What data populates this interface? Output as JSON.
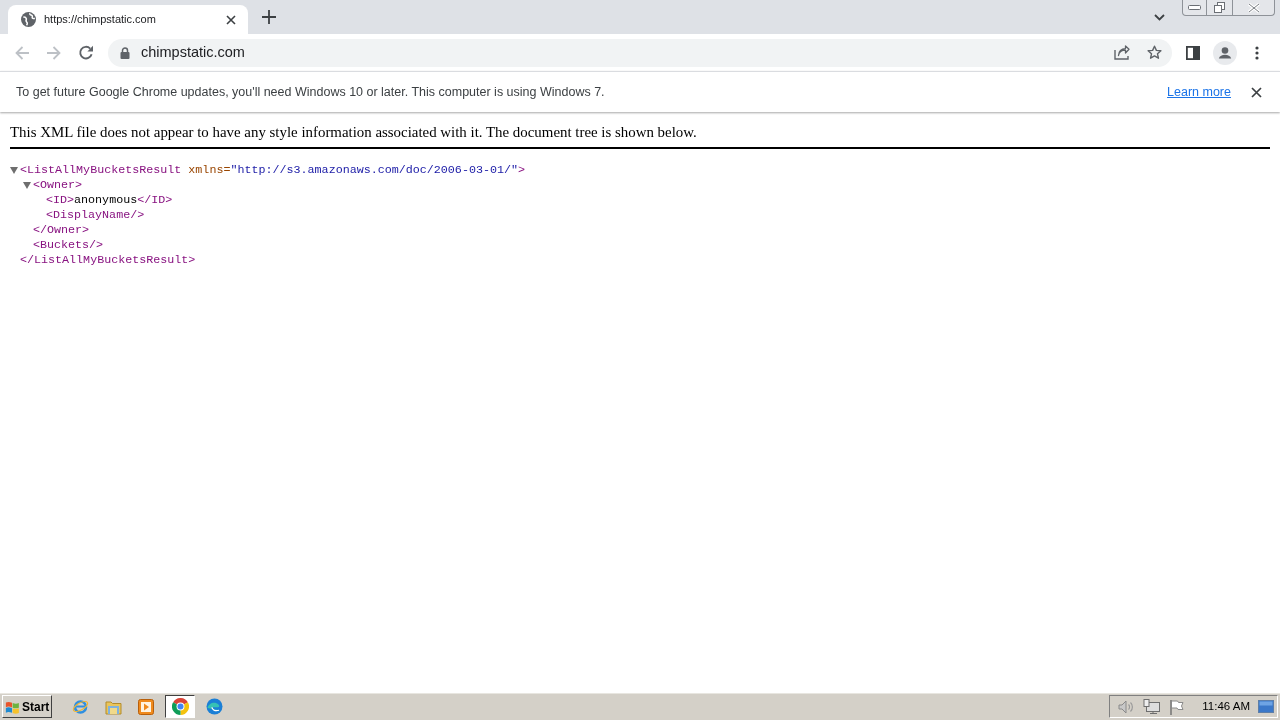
{
  "browser": {
    "tab": {
      "title": "https://chimpstatic.com"
    },
    "nav_buttons": [
      {
        "kind": "back",
        "disabled": true
      },
      {
        "kind": "forward",
        "disabled": true
      },
      {
        "kind": "reload",
        "disabled": false
      }
    ],
    "address": "chimpstatic.com"
  },
  "infobar": {
    "message": "To get future Google Chrome updates, you'll need Windows 10 or later. This computer is using Windows 7.",
    "link": "Learn more"
  },
  "xml_viewer": {
    "notice": "This XML file does not appear to have any style information associated with it. The document tree is shown below.",
    "tree": [
      {
        "kind": "element",
        "expanded": true,
        "open_tag": "<ListAllMyBucketsResult",
        "attributes": [
          {
            "name": "xmlns",
            "separator": "=",
            "value": "\"http://s3.amazonaws.com/doc/2006-03-01/\""
          }
        ],
        "open_tag_end": ">",
        "children": [
          {
            "kind": "element",
            "expanded": true,
            "open_tag": "<Owner",
            "open_tag_end": ">",
            "children": [
              {
                "kind": "text_element",
                "open_tag": "<ID>",
                "text": "anonymous",
                "close_tag": "</ID>"
              },
              {
                "kind": "empty_element",
                "tag": "<DisplayName/>"
              }
            ],
            "close_tag": "</Owner>"
          },
          {
            "kind": "empty_element",
            "tag": "<Buckets/>"
          }
        ],
        "close_tag": "</ListAllMyBucketsResult>"
      }
    ]
  },
  "taskbar": {
    "start": "Start",
    "apps": [
      {
        "kind": "orbit",
        "selected": false
      },
      {
        "kind": "folder",
        "selected": false
      },
      {
        "kind": "player",
        "selected": false
      },
      {
        "kind": "ring",
        "selected": true
      },
      {
        "kind": "swirl",
        "selected": false
      }
    ],
    "clock": "11:46 AM"
  }
}
